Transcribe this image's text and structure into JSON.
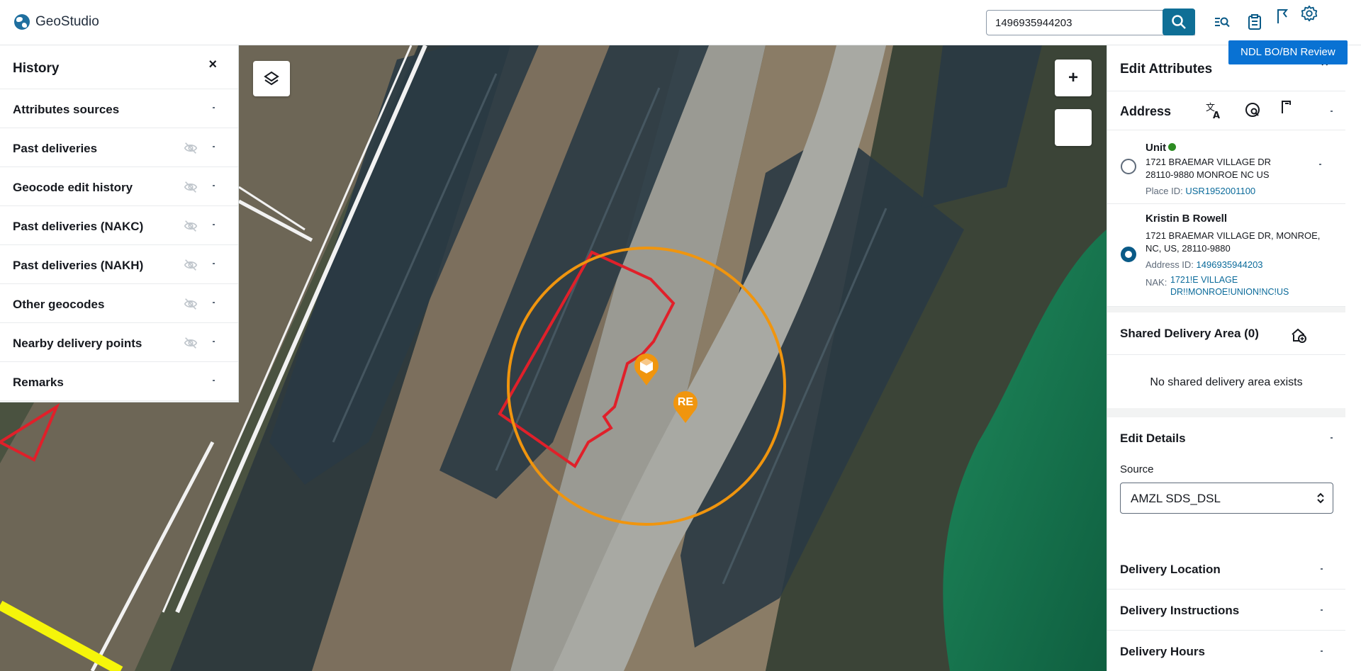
{
  "app": {
    "name": "GeoStudio"
  },
  "search": {
    "value": "1496935944203",
    "clear_label": "×"
  },
  "review_badge": "NDL BO/BN Review",
  "history": {
    "title": "History",
    "close_label": "×",
    "items": [
      {
        "label": "Attributes sources",
        "hidden_icon": false
      },
      {
        "label": "Past deliveries",
        "hidden_icon": true
      },
      {
        "label": "Geocode edit history",
        "hidden_icon": true
      },
      {
        "label": "Past deliveries (NAKC)",
        "hidden_icon": true
      },
      {
        "label": "Past deliveries (NAKH)",
        "hidden_icon": true
      },
      {
        "label": "Other geocodes",
        "hidden_icon": true
      },
      {
        "label": "Nearby delivery points",
        "hidden_icon": true
      },
      {
        "label": "Remarks",
        "hidden_icon": false
      }
    ]
  },
  "map": {
    "zoom_in_label": "+",
    "marker_re_label": "RE",
    "colors": {
      "parcel": "#e0202a",
      "radius": "#f0950e",
      "road": "#f5f50a"
    }
  },
  "edit_attributes": {
    "title": "Edit Attributes",
    "close_label": "×",
    "address": {
      "title": "Address",
      "cards": [
        {
          "name": "Unit",
          "status": "active",
          "line1": "1721 BRAEMAR VILLAGE DR",
          "line2": "28110-9880 MONROE NC US",
          "id_label": "Place ID:",
          "id_value": "USR1952001100",
          "selected": false
        },
        {
          "name": "Kristin B Rowell",
          "line1": "1721 BRAEMAR VILLAGE DR, MONROE,",
          "line2": "NC, US, 28110-9880",
          "id_label": "Address ID:",
          "id_value": "1496935944203",
          "nak_label": "NAK:",
          "nak_line1": "1721!E VILLAGE",
          "nak_line2": "DR!!MONROE!UNION!NC!US",
          "selected": true
        }
      ]
    },
    "shared_delivery": {
      "title": "Shared Delivery Area (0)",
      "empty_text": "No shared delivery area exists"
    },
    "edit_details": {
      "title": "Edit Details",
      "source_label": "Source",
      "source_value": "AMZL SDS_DSL"
    },
    "sections": [
      "Delivery Location",
      "Delivery Instructions",
      "Delivery Hours"
    ]
  }
}
